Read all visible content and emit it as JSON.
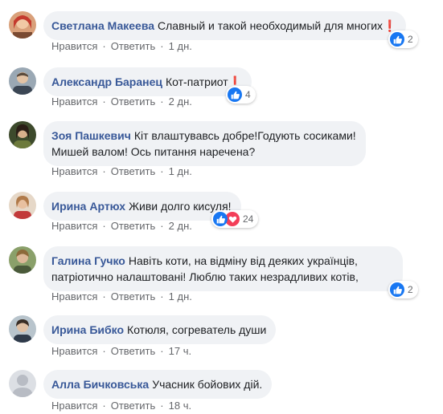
{
  "labels": {
    "like": "Нравится",
    "reply": "Ответить",
    "dot": "·"
  },
  "colors": {
    "author": "#385898",
    "bubble": "#f0f2f5",
    "like_blue": "#1877f2"
  },
  "comments": [
    {
      "author": "Светлана Макеева",
      "text_lines": [
        "Славный и такой необходимый для многих❗"
      ],
      "reactions": "2",
      "reaction_icon": "like-icon",
      "time": "1 дн."
    },
    {
      "author": "Александр Баранец",
      "text_lines": [
        "Кот-патриот❗"
      ],
      "reactions": "4",
      "reaction_icon": "like-icon",
      "time": "2 дн."
    },
    {
      "author": "Зоя Пашкевич",
      "text_lines": [
        "Кіт влаштувавсь добре!Годують сосиками!",
        "Мишей валом! Ось питання наречена?"
      ],
      "reactions": "",
      "time": "1 дн."
    },
    {
      "author": "Ирина Артюх",
      "text_lines": [
        "Живи долго кисуля!"
      ],
      "reactions": "24",
      "reaction_icon": "like-heart-icon",
      "time": "2 дн."
    },
    {
      "author": "Галина Гучко",
      "text_lines": [
        "Навіть коти, на відміну від деяких українців,",
        "патріотично налаштовані! Люблю таких незрадливих котів,"
      ],
      "reactions": "2",
      "reaction_icon": "like-icon",
      "time": "1 дн."
    },
    {
      "author": "Ирина Бибко",
      "text_lines": [
        "Котюля, согреватель души"
      ],
      "reactions": "",
      "time": "17 ч."
    },
    {
      "author": "Алла Бичковська",
      "text_lines": [
        "Учасник бойових дій."
      ],
      "reactions": "",
      "time": "18 ч."
    }
  ]
}
